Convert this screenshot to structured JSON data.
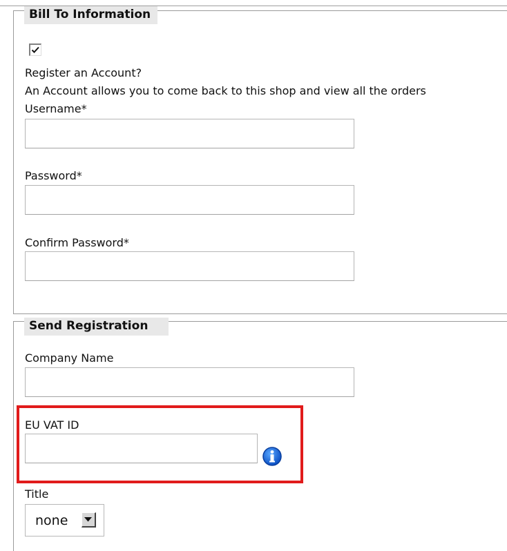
{
  "bill_to": {
    "legend": "Bill To Information",
    "register_checked": true,
    "register_label": "Register an Account?",
    "register_description": "An Account allows you to come back to this shop and view all the orders",
    "username_label": "Username*",
    "username_value": "",
    "password_label": "Password*",
    "password_value": "",
    "confirm_password_label": "Confirm Password*",
    "confirm_password_value": ""
  },
  "send_registration": {
    "legend": "Send Registration",
    "company_label": "Company Name",
    "company_value": "",
    "vat_label": "EU VAT ID",
    "vat_value": "",
    "title_label": "Title",
    "title_selected": "none"
  },
  "icons": {
    "checkbox_mark": "checkmark-icon",
    "vat_info": "info-icon",
    "select_arrow": "chevron-down-icon"
  },
  "colors": {
    "highlight": "#e11b1b",
    "info_icon": "#1565d8",
    "legend_bg": "#e8e8e8"
  }
}
